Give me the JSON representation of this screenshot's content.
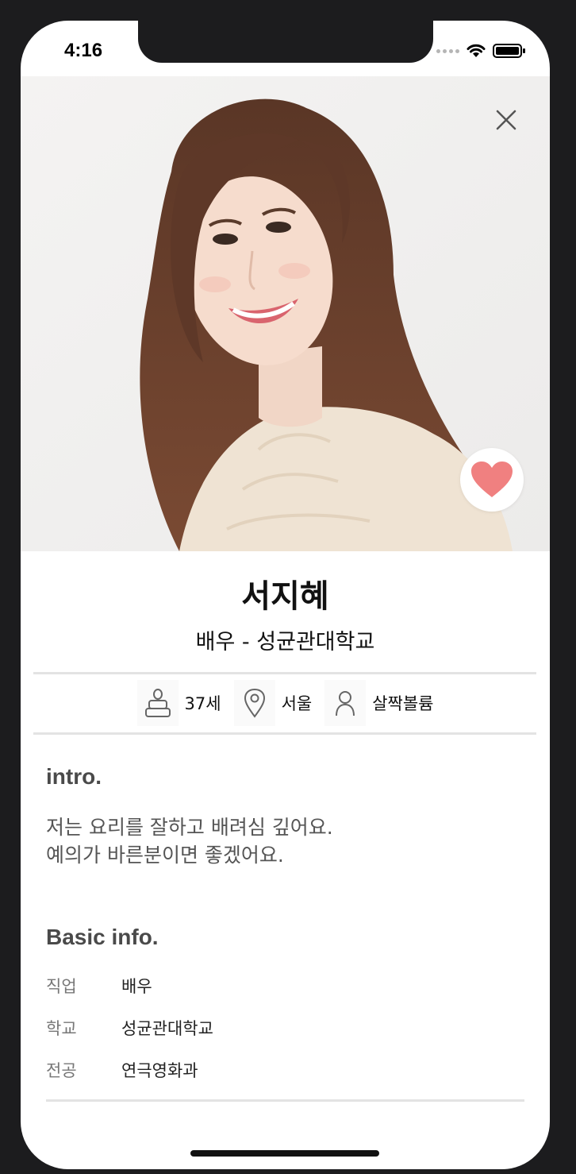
{
  "status": {
    "time": "4:16"
  },
  "profile": {
    "name": "서지혜",
    "subtitle": "배우 - 성균관대학교"
  },
  "stats": {
    "age": "37세",
    "location": "서울",
    "body_type": "살짝볼륨"
  },
  "intro": {
    "title": "intro.",
    "line1": "저는 요리를 잘하고 배려심 깊어요.",
    "line2": "예의가 바른분이면 좋겠어요."
  },
  "basic_info": {
    "title": "Basic info.",
    "rows": [
      {
        "label": "직업",
        "value": "배우"
      },
      {
        "label": "학교",
        "value": "성균관대학교"
      },
      {
        "label": "전공",
        "value": "연극영화과"
      }
    ]
  },
  "colors": {
    "heart": "#f08080",
    "divider": "#e3e3e3",
    "background": "#1c1c1e"
  },
  "icons": [
    "close-icon",
    "heart-icon",
    "cake-icon",
    "location-pin-icon",
    "person-icon",
    "wifi-icon",
    "battery-icon"
  ]
}
